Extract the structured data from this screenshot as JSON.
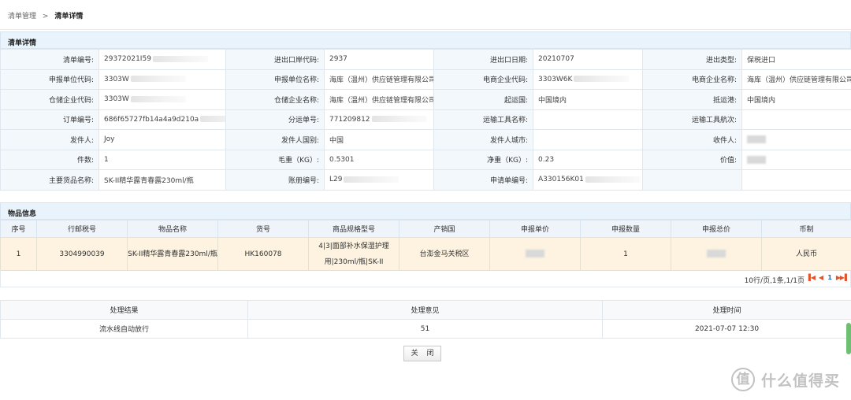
{
  "breadcrumb": {
    "parent": "清单管理",
    "separator": ">",
    "current": "清单详情"
  },
  "detail": {
    "title": "清单详情",
    "rows": [
      [
        {
          "label": "清单编号:",
          "value": "29372021I59",
          "masked": true
        },
        {
          "label": "进出口岸代码:",
          "value": "2937"
        },
        {
          "label": "进出口日期:",
          "value": "20210707"
        },
        {
          "label": "进出类型:",
          "value": "保税进口"
        }
      ],
      [
        {
          "label": "申报单位代码:",
          "value": "3303W",
          "masked": true
        },
        {
          "label": "申报单位名称:",
          "value": "海库（温州）供应链管理有限公司"
        },
        {
          "label": "电商企业代码:",
          "value": "3303W6K",
          "masked": true
        },
        {
          "label": "电商企业名称:",
          "value": "海库（温州）供应链管理有限公司"
        }
      ],
      [
        {
          "label": "仓储企业代码:",
          "value": "3303W",
          "masked": true
        },
        {
          "label": "仓储企业名称:",
          "value": "海库（温州）供应链管理有限公司"
        },
        {
          "label": "起运国:",
          "value": "中国境内"
        },
        {
          "label": "抵运港:",
          "value": "中国境内"
        }
      ],
      [
        {
          "label": "订单编号:",
          "value": "686f65727fb14a4a9d210a",
          "masked": true
        },
        {
          "label": "分运单号:",
          "value": "771209812",
          "masked": true
        },
        {
          "label": "运输工具名称:",
          "value": ""
        },
        {
          "label": "运输工具航次:",
          "value": ""
        }
      ],
      [
        {
          "label": "发件人:",
          "value": "Joy"
        },
        {
          "label": "发件人国别:",
          "value": "中国"
        },
        {
          "label": "发件人城市:",
          "value": ""
        },
        {
          "label": "收件人:",
          "value": "",
          "masked": true
        }
      ],
      [
        {
          "label": "件数:",
          "value": "1"
        },
        {
          "label": "毛重（KG）:",
          "value": "0.5301"
        },
        {
          "label": "净重（KG）:",
          "value": "0.23"
        },
        {
          "label": "价值:",
          "value": "",
          "masked": true
        }
      ],
      [
        {
          "label": "主要货品名称:",
          "value": "SK-II精华露青春露230ml/瓶"
        },
        {
          "label": "账册编号:",
          "value": "L29",
          "masked": true
        },
        {
          "label": "申请单编号:",
          "value": "A330156K01",
          "masked": true
        },
        {
          "label": "",
          "value": ""
        }
      ]
    ]
  },
  "goods": {
    "title": "物品信息",
    "columns": [
      "序号",
      "行邮税号",
      "物品名称",
      "货号",
      "商品规格型号",
      "产销国",
      "申报单价",
      "申报数量",
      "申报总价",
      "币制"
    ],
    "rows": [
      [
        "1",
        "3304990039",
        "SK-II精华露青春露230ml/瓶",
        "HK160078",
        "4|3|面部补水保湿护理用|230ml/瓶|SK-II",
        "台澎金马关税区",
        "",
        "1",
        "",
        "人民币"
      ]
    ],
    "pager": {
      "text": "10行/页,1条,1/1页",
      "current_page": "1"
    }
  },
  "result": {
    "columns": [
      "处理结果",
      "处理意见",
      "处理时间"
    ],
    "rows": [
      [
        "流水线自动放行",
        "51",
        "2021-07-07 12:30"
      ]
    ]
  },
  "actions": {
    "close_label": "关 闭"
  },
  "watermark": {
    "logo": "值",
    "text": "什么值得买"
  }
}
